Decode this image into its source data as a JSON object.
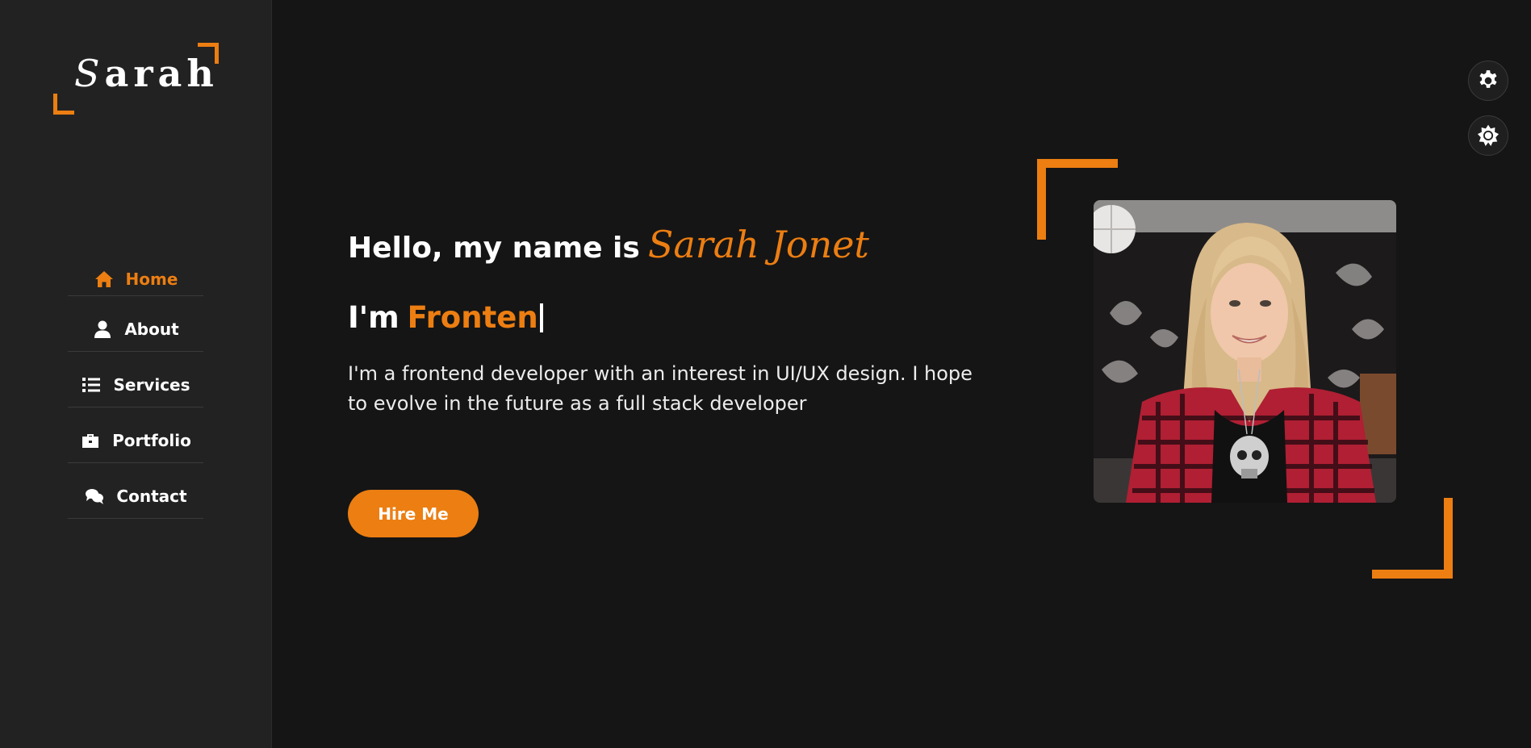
{
  "theme": {
    "accent": "#ec7e12",
    "background": "#151515",
    "sidebar_background": "#222222",
    "text": "#ffffff"
  },
  "sidebar": {
    "logo": {
      "initial": "S",
      "rest": "arah"
    },
    "nav": [
      {
        "label": "Home",
        "icon": "home-icon",
        "active": true
      },
      {
        "label": "About",
        "icon": "user-icon",
        "active": false
      },
      {
        "label": "Services",
        "icon": "list-icon",
        "active": false
      },
      {
        "label": "Portfolio",
        "icon": "briefcase-icon",
        "active": false
      },
      {
        "label": "Contact",
        "icon": "comments-icon",
        "active": false
      }
    ]
  },
  "controls": {
    "settings_icon": "gear-icon",
    "theme_icon": "sun-icon"
  },
  "home": {
    "greeting_prefix": "Hello, my name is",
    "name": "Sarah Jonet",
    "role_prefix": "I'm",
    "role_typed": "Fronten",
    "intro": "I'm a frontend developer with an interest in UI/UX design. I hope to evolve in the future as a full stack developer",
    "cta_label": "Hire Me"
  }
}
